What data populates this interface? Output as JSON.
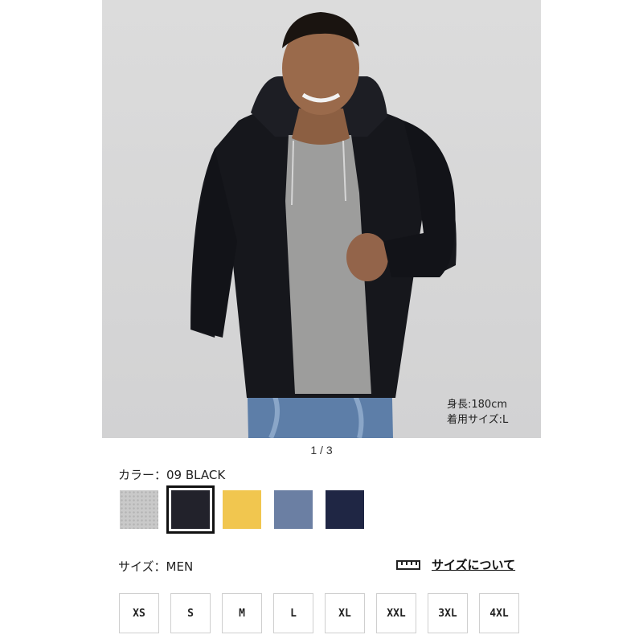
{
  "product": {
    "image_alt": "Model wearing black zip hoodie over grey t-shirt",
    "model_height": "身長:180cm",
    "model_size": "着用サイズ:L",
    "pager": "1 / 3"
  },
  "color": {
    "label": "カラー：09 BLACK",
    "swatches": [
      {
        "name": "gray",
        "color": "#c9c9c9"
      },
      {
        "name": "black",
        "color": "#22222b"
      },
      {
        "name": "yellow",
        "color": "#f1c64f"
      },
      {
        "name": "blue",
        "color": "#6b7fa3"
      },
      {
        "name": "navy",
        "color": "#1f2644"
      }
    ],
    "selected": "black"
  },
  "size": {
    "label": "サイズ：MEN",
    "guide_label": "サイズについて",
    "options": [
      "XS",
      "S",
      "M",
      "L",
      "XL",
      "XXL",
      "3XL",
      "4XL"
    ]
  },
  "icons": {
    "wishlist": "heart-plus-icon",
    "size_guide": "ruler-icon"
  }
}
